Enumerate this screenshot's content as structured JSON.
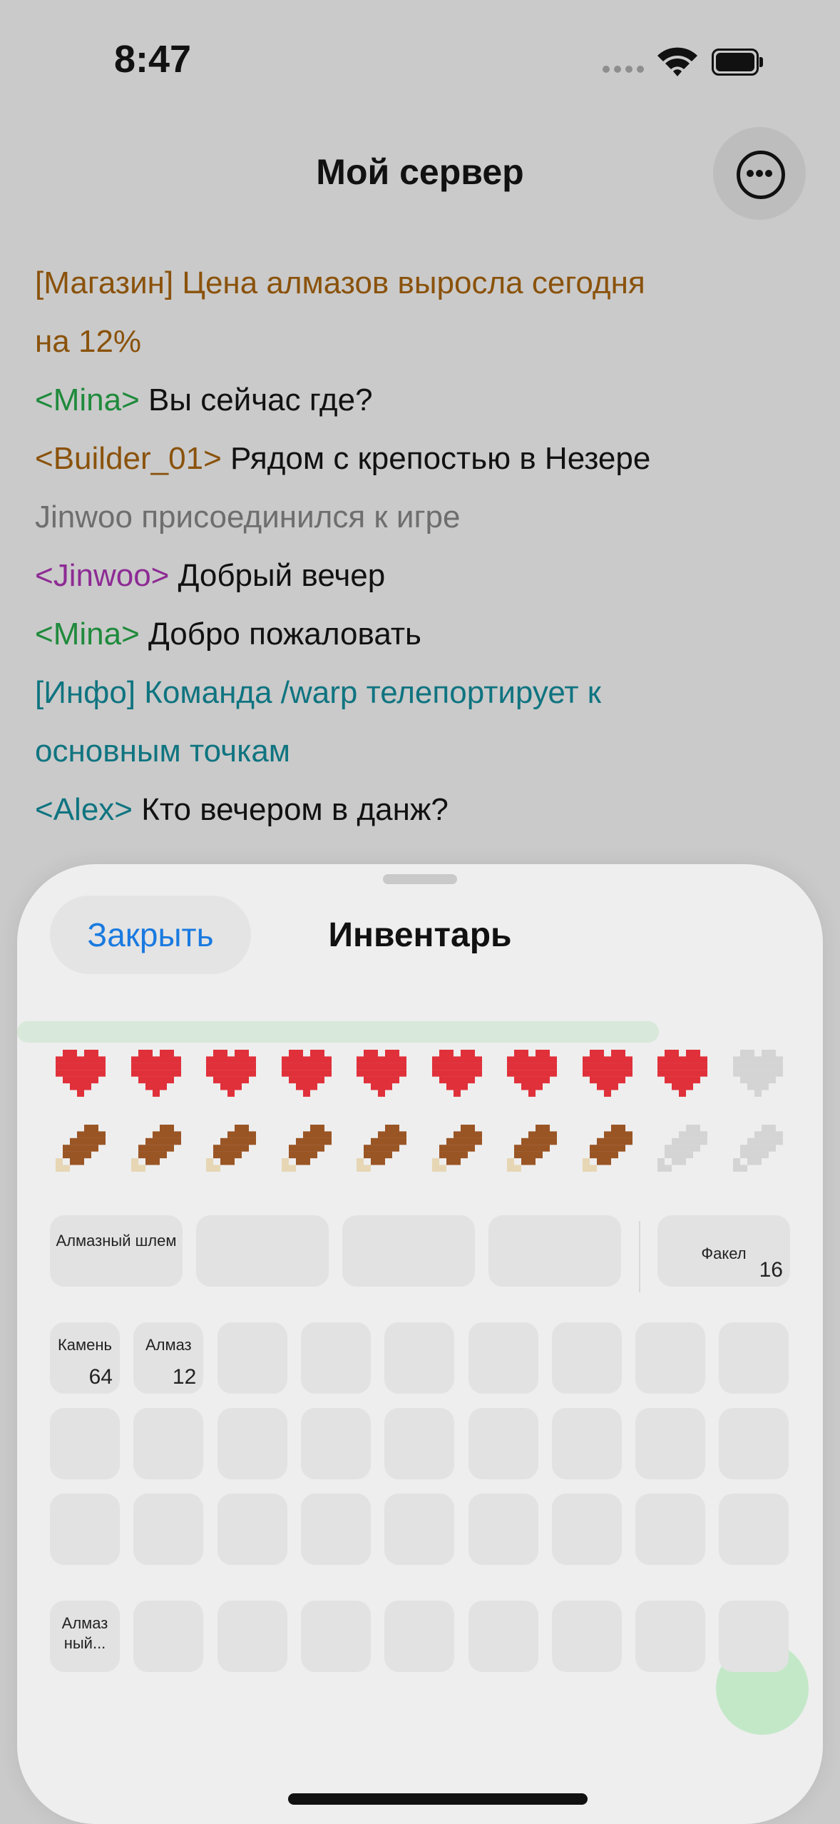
{
  "status": {
    "time": "8:47"
  },
  "nav": {
    "title": "Мой сервер",
    "more_icon": "ellipsis-circle-icon"
  },
  "chat": [
    {
      "parts": [
        {
          "text": "[Магазин] Цена алмазов выросла сегодня",
          "cls": "c-shop"
        }
      ]
    },
    {
      "parts": [
        {
          "text": "на 12%",
          "cls": "c-shop"
        }
      ]
    },
    {
      "parts": [
        {
          "text": "<Mina>",
          "cls": "n-mina"
        },
        {
          "text": " Вы сейчас где?",
          "cls": ""
        }
      ]
    },
    {
      "parts": [
        {
          "text": "<Builder_01>",
          "cls": "n-builder"
        },
        {
          "text": " Рядом с крепостью в Незере",
          "cls": ""
        }
      ]
    },
    {
      "parts": [
        {
          "text": "Jinwoo присоединился к игре",
          "cls": "c-gray"
        }
      ]
    },
    {
      "parts": [
        {
          "text": "<Jinwoo>",
          "cls": "n-jinwoo"
        },
        {
          "text": " Добрый вечер",
          "cls": ""
        }
      ]
    },
    {
      "parts": [
        {
          "text": "<Mina>",
          "cls": "n-mina"
        },
        {
          "text": " Добро пожаловать",
          "cls": ""
        }
      ]
    },
    {
      "parts": [
        {
          "text": "[Инфо] Команда /warp телепортирует к",
          "cls": "c-info"
        }
      ]
    },
    {
      "parts": [
        {
          "text": "основным точкам",
          "cls": "c-info"
        }
      ]
    },
    {
      "parts": [
        {
          "text": "<Alex>",
          "cls": "n-alex"
        },
        {
          "text": " Кто вечером в данж?",
          "cls": ""
        }
      ]
    }
  ],
  "sheet": {
    "close_label": "Закрыть",
    "title": "Инвентарь",
    "health": {
      "filled": 9,
      "total": 10
    },
    "hunger": {
      "filled": 8,
      "total": 10
    },
    "armor_slots": [
      {
        "name": "Алмазный шлем",
        "count": ""
      },
      {
        "name": "",
        "count": ""
      },
      {
        "name": "",
        "count": ""
      },
      {
        "name": "",
        "count": ""
      }
    ],
    "offhand_slot": {
      "name": "Факел",
      "count": "16"
    },
    "grid": [
      [
        {
          "name": "Камень",
          "count": "64"
        },
        {
          "name": "Алмаз",
          "count": "12"
        },
        {},
        {},
        {},
        {},
        {},
        {},
        {}
      ],
      [
        {},
        {},
        {},
        {},
        {},
        {},
        {},
        {},
        {}
      ],
      [
        {},
        {},
        {},
        {},
        {},
        {},
        {},
        {},
        {}
      ],
      [
        {
          "name": "Алмаз ный...",
          "count": ""
        },
        {},
        {},
        {},
        {},
        {},
        {},
        {},
        {}
      ]
    ],
    "colors": {
      "heart_full": "#e0303a",
      "heart_empty": "#d4d4d4",
      "food_full": "#9a5525",
      "food_bone": "#e6d6b4",
      "food_empty": "#d4d4d4",
      "accent": "#1a7ae0"
    }
  }
}
